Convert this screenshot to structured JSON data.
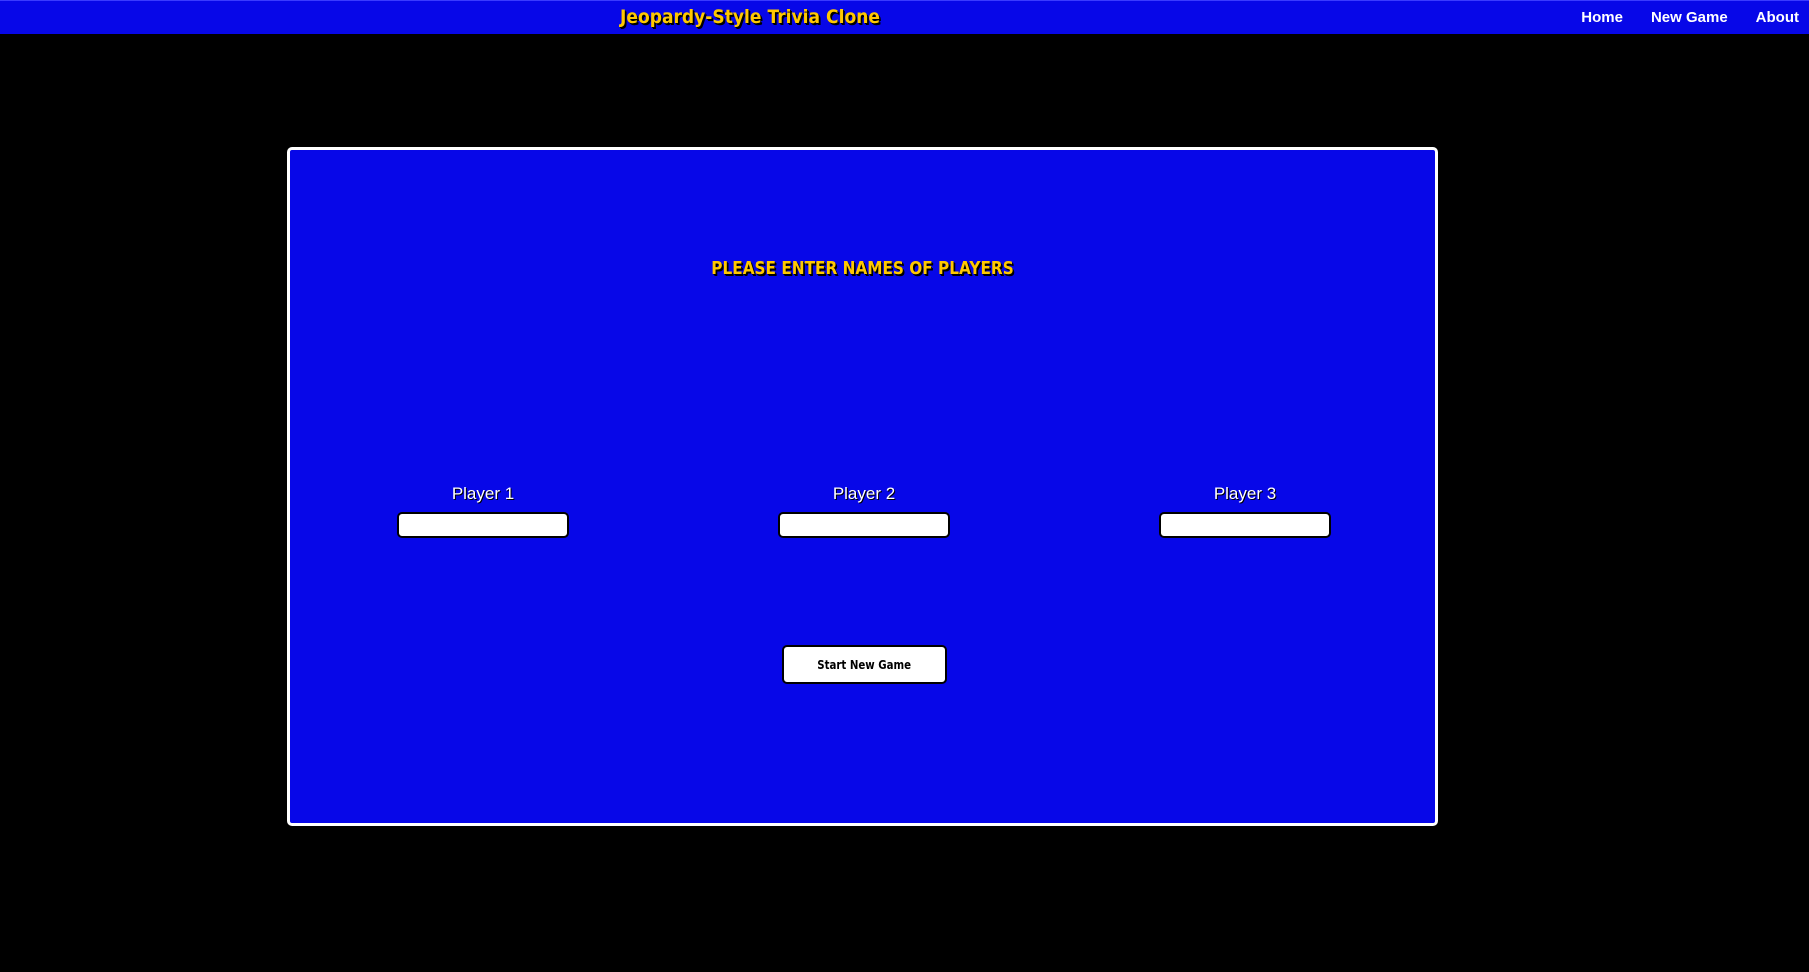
{
  "header": {
    "brand": "Jeopardy-Style Trivia Clone",
    "nav": [
      "Home",
      "New Game",
      "About"
    ]
  },
  "main": {
    "prompt": "PLEASE ENTER NAMES OF PLAYERS",
    "players": [
      {
        "label": "Player 1",
        "value": ""
      },
      {
        "label": "Player 2",
        "value": ""
      },
      {
        "label": "Player 3",
        "value": ""
      }
    ],
    "start_button": "Start New Game"
  },
  "colors": {
    "background": "#000000",
    "panel": "#0707e8",
    "title_gold": "#ffc800",
    "border": "#ffffff"
  }
}
